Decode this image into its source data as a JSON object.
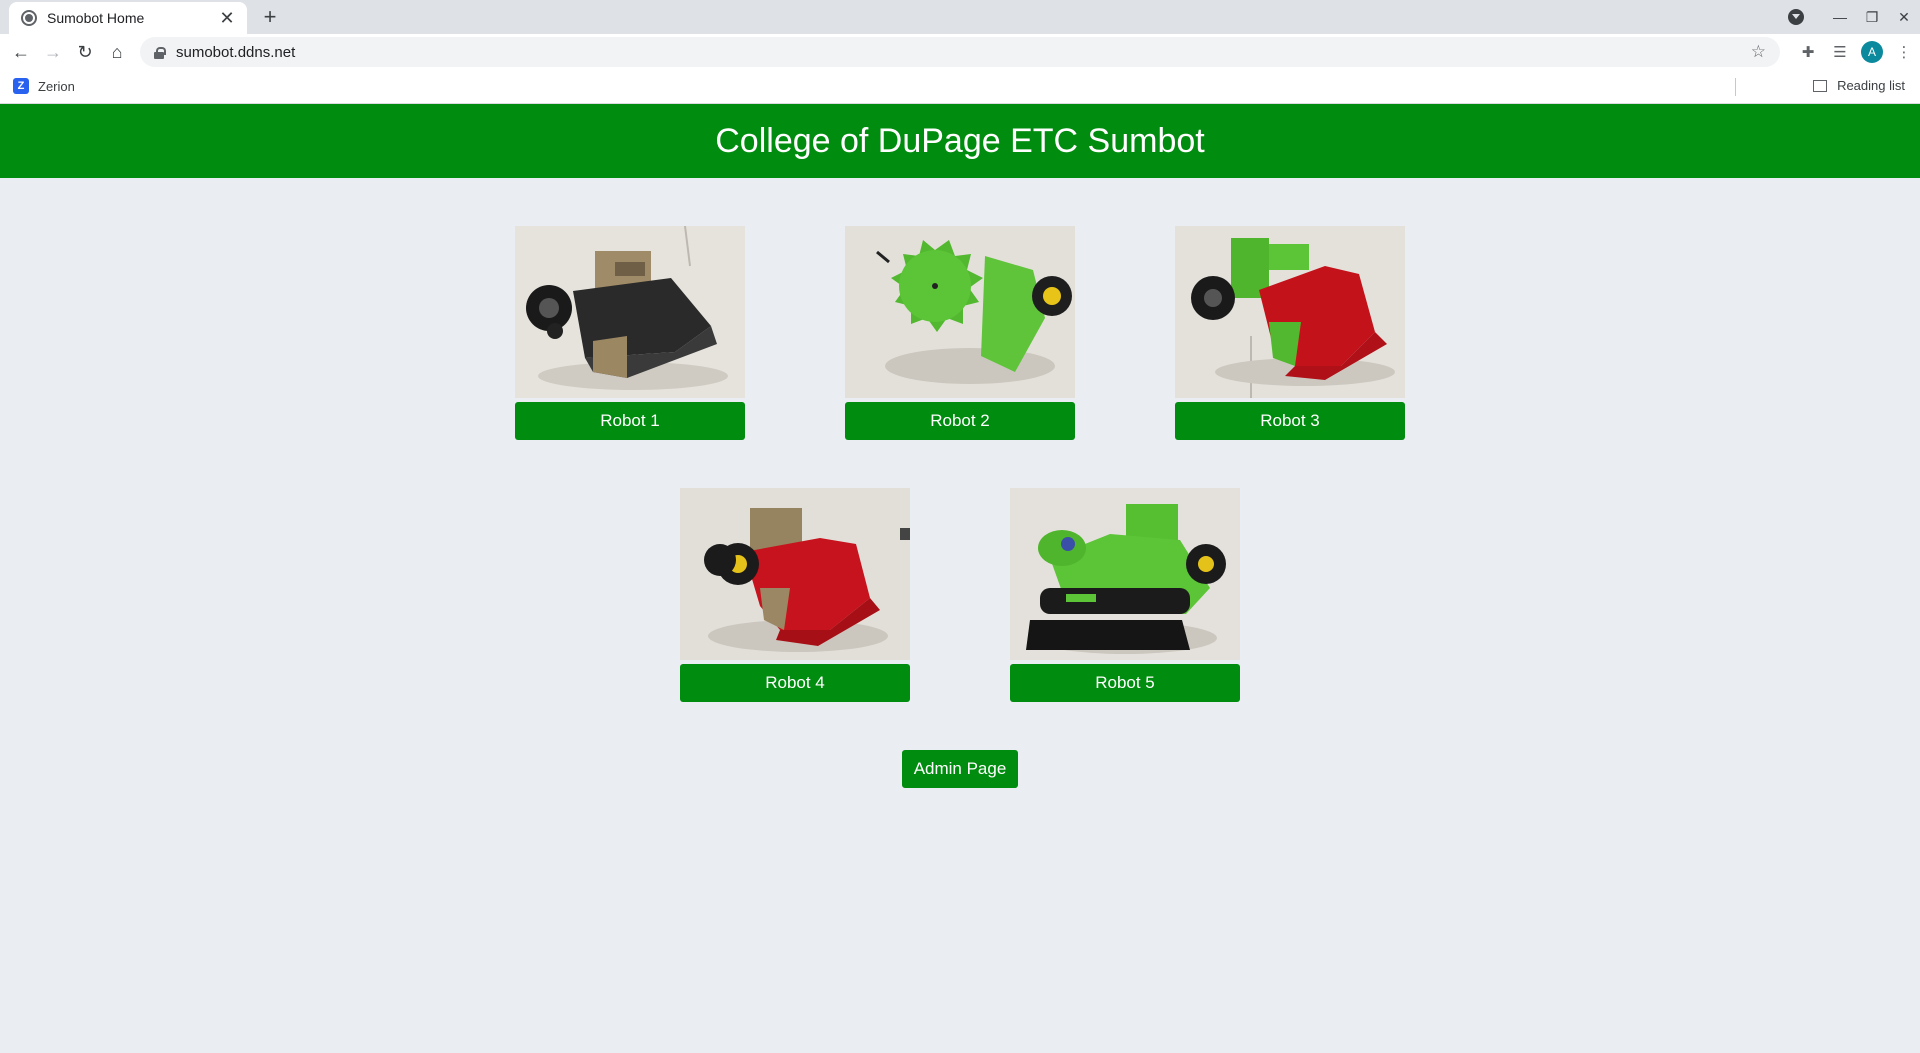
{
  "browser": {
    "tab_title": "Sumobot Home",
    "url": "sumobot.ddns.net",
    "bookmarks": [
      {
        "label": "Zerion"
      }
    ],
    "reading_list_label": "Reading list",
    "profile_initial": "A"
  },
  "header": {
    "title": "College of DuPage ETC Sumbot"
  },
  "robots": [
    {
      "label": "Robot 1",
      "icon": "robot-photo-black-tan-wedge"
    },
    {
      "label": "Robot 2",
      "icon": "robot-photo-green-saw"
    },
    {
      "label": "Robot 3",
      "icon": "robot-photo-green-red-wedge"
    },
    {
      "label": "Robot 4",
      "icon": "robot-photo-red-tan-wedge"
    },
    {
      "label": "Robot 5",
      "icon": "robot-photo-green-black-roller"
    }
  ],
  "admin": {
    "label": "Admin Page"
  },
  "colors": {
    "brand_green": "#008c0e",
    "page_background": "#eaeef2"
  }
}
